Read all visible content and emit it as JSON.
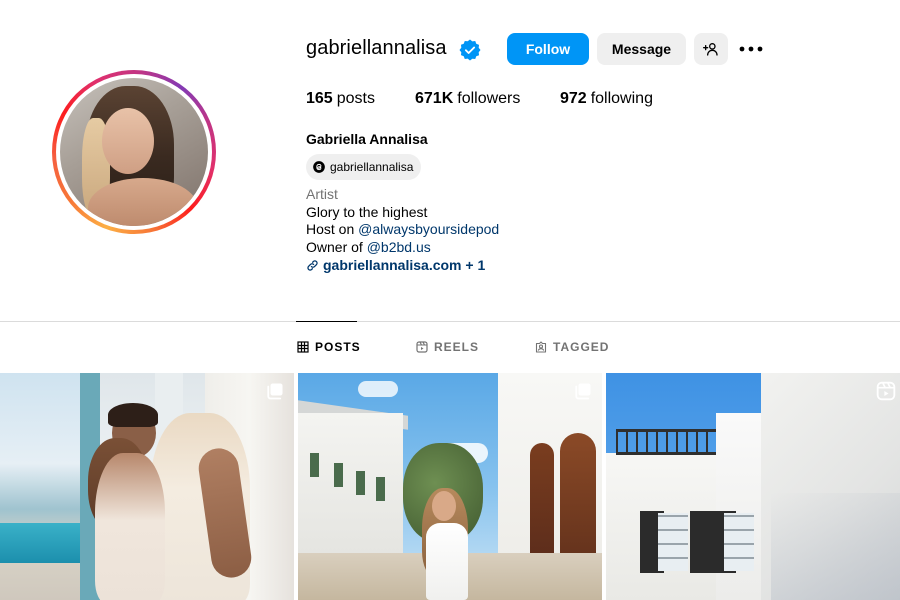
{
  "profile": {
    "username": "gabriellannalisa",
    "verified": true,
    "full_name": "Gabriella Annalisa",
    "threads_handle": "gabriellannalisa",
    "stats": {
      "posts_count": "165",
      "posts_label": "posts",
      "followers_count": "671K",
      "followers_label": "followers",
      "following_count": "972",
      "following_label": "following"
    },
    "bio": {
      "category": "Artist",
      "line1": "Glory to the highest",
      "line2_prefix": "Host on ",
      "line2_mention": "@alwaysbyoursidepod",
      "line3_prefix": "Owner of ",
      "line3_mention": "@b2bd.us",
      "link_text": "gabriellannalisa.com + 1"
    }
  },
  "actions": {
    "follow_label": "Follow",
    "message_label": "Message",
    "add_user_icon": "add-user-icon",
    "more_icon": "more-horizontal-icon"
  },
  "tabs": [
    {
      "label": "POSTS",
      "icon": "grid-icon",
      "active": true
    },
    {
      "label": "REELS",
      "icon": "reels-icon",
      "active": false
    },
    {
      "label": "TAGGED",
      "icon": "tagged-icon",
      "active": false
    }
  ],
  "posts": [
    {
      "type": "carousel",
      "icon": "carousel-icon"
    },
    {
      "type": "carousel",
      "icon": "carousel-icon"
    },
    {
      "type": "reel",
      "icon": "reel-icon"
    }
  ],
  "colors": {
    "accent": "#0095f6",
    "link": "#00376b",
    "secondary_text": "#737373",
    "button_bg": "#efefef"
  }
}
